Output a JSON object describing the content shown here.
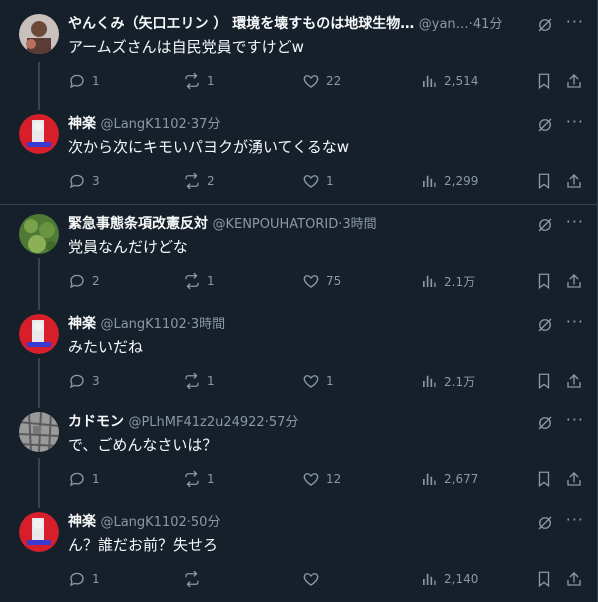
{
  "tweets": [
    {
      "name": "やんくみ（矢口エリン ） 環境を壊すものは地球生物…",
      "handle": "@yan…",
      "time": "41分",
      "text": "アームズさんは自民党員ですけどw",
      "replies": "1",
      "retweets": "1",
      "likes": "22",
      "views": "2,514",
      "avatar": "avatar-yankumi"
    },
    {
      "name": "神楽",
      "handle": "@LangK1102",
      "time": "37分",
      "text": "次から次にキモいパヨクが湧いてくるなw",
      "replies": "3",
      "retweets": "2",
      "likes": "1",
      "views": "2,299",
      "avatar": "avatar-kagura"
    },
    {
      "name": "緊急事態条項改憲反対",
      "handle": "@KENPOUHATORID",
      "time": "3時間",
      "text": "党員なんだけどな",
      "replies": "2",
      "retweets": "1",
      "likes": "75",
      "views": "2.1万",
      "avatar": "avatar-kenpou"
    },
    {
      "name": "神楽",
      "handle": "@LangK1102",
      "time": "3時間",
      "text": "みたいだね",
      "replies": "3",
      "retweets": "1",
      "likes": "1",
      "views": "2.1万",
      "avatar": "avatar-kagura"
    },
    {
      "name": "カドモン",
      "handle": "@PLhMF41z2u24922",
      "time": "57分",
      "text": "で、ごめんなさいは？",
      "replies": "1",
      "retweets": "1",
      "likes": "12",
      "views": "2,677",
      "avatar": "avatar-kadomon"
    },
    {
      "name": "神楽",
      "handle": "@LangK1102",
      "time": "50分",
      "text": "ん？誰だお前？失せろ",
      "replies": "1",
      "retweets": "",
      "likes": "",
      "views": "2,140",
      "avatar": "avatar-kagura"
    }
  ],
  "sep": "·",
  "more_glyph": "···",
  "colors": {
    "background": "#15202b",
    "text": "#f7f9f9",
    "secondary": "#8b98a5",
    "border": "#38444d"
  }
}
